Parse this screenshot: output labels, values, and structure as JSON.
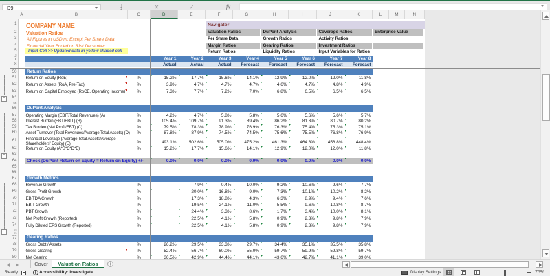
{
  "app": {
    "name_box": "D9",
    "formula_bar": ""
  },
  "colors": {
    "excel_green": "#217346",
    "section_band_blue": "#4f81bd",
    "status_band_blue": "#dce6f1",
    "title_orange": "#ed7d31",
    "input_yellow": "#ffff99",
    "navigator_lavender": "#d8d4e6",
    "navigator_gray": "#bfbfbf",
    "check_blue": "#2121cc",
    "error_indicator_green": "#1e7e3e",
    "flag_red": "#d03020"
  },
  "columns": [
    "A",
    "B",
    "C",
    "D",
    "E",
    "F",
    "G",
    "H",
    "I",
    "J",
    "K",
    "L",
    "M",
    "N"
  ],
  "row_numbers": [
    1,
    2,
    3,
    4,
    5,
    6,
    7,
    8,
    50,
    51,
    52,
    53,
    54,
    55,
    56,
    57,
    58,
    59,
    60,
    61,
    62,
    63,
    64,
    65,
    66,
    67,
    68,
    69,
    70,
    71,
    72,
    73,
    74,
    75,
    76,
    77,
    78,
    79,
    80
  ],
  "outline_levels": [
    "1",
    "2"
  ],
  "title_block": {
    "company": "COMPANY NAME",
    "sheet_title": "Valuation Ratios",
    "note1": "All Figures in USD m; Except Per Share Data",
    "note2": "Financial Year Ended on 31st December",
    "input_note": "Input Cell >> Updated data in yellow shaded cell"
  },
  "navigator": {
    "title": "Navigator",
    "rows": [
      {
        "filled": true,
        "cells": [
          "Valuation Ratios",
          "DuPont Analysis",
          "Coverage Ratios",
          "Enterprise Value"
        ]
      },
      {
        "filled": false,
        "cells": [
          "Per Share Data",
          "Growth Ratios",
          "Activity Ratios",
          ""
        ]
      },
      {
        "filled": true,
        "cells": [
          "Margin Ratios",
          "Gearing Ratios",
          "Investment Ratios",
          ""
        ]
      },
      {
        "filled": false,
        "cells": [
          "Return Ratios",
          "Liquidity Ratios",
          "Input Variables for Ratios",
          ""
        ]
      }
    ]
  },
  "table": {
    "year_header": [
      "Year 1",
      "Year 2",
      "Year 3",
      "Year 4",
      "Year 5",
      "Year 6",
      "Year 7",
      "Year 8"
    ],
    "status_row": [
      "Actual",
      "Actual",
      "Actual",
      "Forecast",
      "Forecast",
      "Forecast",
      "Forecast",
      "Forecast"
    ],
    "sections": [
      {
        "row": 50,
        "title": "Return Ratios",
        "rows": [
          {
            "row": 51,
            "label": "Return on Equity (RoE)",
            "unit": "%",
            "flag": true,
            "values": [
              "15.2%",
              "17.7%",
              "15.6%",
              "14.1%",
              "12.9%",
              "12.0%",
              "12.0%",
              "11.8%"
            ]
          },
          {
            "row": 52,
            "label": "Return on Assets (RoA, Pre-Tax)",
            "unit": "%",
            "flag": true,
            "values": [
              "3.9%",
              "4.7%",
              "4.7%",
              "4.7%",
              "4.6%",
              "4.7%",
              "4.8%",
              "4.9%"
            ]
          },
          {
            "row": 53,
            "label": "Return on Capital Employed (RoCE, Operating Income)",
            "unit": "%",
            "flag": true,
            "values": [
              "7.3%",
              "7.7%",
              "7.2%",
              "7.0%",
              "6.8%",
              "6.5%",
              "6.5%",
              "6.5%"
            ]
          }
        ]
      },
      {
        "row": 56,
        "title": "DuPont Analysis",
        "rows": [
          {
            "row": 57,
            "label": "Operating Margin (EBIT/Total Revenues) (A)",
            "unit": "%",
            "values": [
              "4.2%",
              "4.7%",
              "5.8%",
              "5.8%",
              "5.6%",
              "5.6%",
              "5.6%",
              "5.7%"
            ]
          },
          {
            "row": 58,
            "label": "Interest Burden (EBT/EBIT) (B)",
            "unit": "%",
            "values": [
              "105.4%",
              "109.7%",
              "91.3%",
              "89.4%",
              "86.2%",
              "81.3%",
              "80.7%",
              "80.2%"
            ]
          },
          {
            "row": 59,
            "label": "Tax Burden (Net Profit/EBT) (C)",
            "unit": "%",
            "values": [
              "79.5%",
              "78.3%",
              "78.9%",
              "76.9%",
              "76.3%",
              "75.4%",
              "75.3%",
              "75.1%"
            ]
          },
          {
            "row": 60,
            "label": "Asset Turnover (Total Revenues/Average Total Assets) (D)",
            "unit": "%",
            "values": [
              "87.8%",
              "87.9%",
              "74.5%",
              "74.5%",
              "75.6%",
              "75.5%",
              "76.8%",
              "76.9%"
            ]
          },
          {
            "row": 61,
            "label": "Financial Leverage (Average Total Assets/Average Shareholders' Equity) (E)",
            "two_line": true,
            "unit": "%",
            "values": [
              "493.1%",
              "502.6%",
              "505.0%",
              "475.2%",
              "461.3%",
              "464.8%",
              "456.8%",
              "448.4%"
            ]
          },
          {
            "row": 62,
            "label": "Return on Equity (A*B*C*D*E)",
            "unit": "%",
            "values": [
              "15.2%",
              "17.7%",
              "15.6%",
              "14.1%",
              "12.9%",
              "12.0%",
              "12.0%",
              "11.8%"
            ]
          }
        ]
      },
      {
        "row": 64,
        "title": "Check (DuPont Return on Equity = Return on Equity) +/-",
        "check": true,
        "values": [
          "0.0%",
          "0.0%",
          "0.0%",
          "0.0%",
          "0.0%",
          "0.0%",
          "0.0%",
          "0.0%"
        ],
        "rows": []
      },
      {
        "row": 67,
        "title": "Growth Metrics",
        "rows": [
          {
            "row": 68,
            "label": "Revenue Growth",
            "unit": "%",
            "values": [
              "",
              "7.9%",
              "0.4%",
              "10.0%",
              "9.2%",
              "10.6%",
              "9.6%",
              "7.7%"
            ]
          },
          {
            "row": 69,
            "label": "Gross Profit Growth",
            "unit": "%",
            "values": [
              "",
              "20.0%",
              "16.8%",
              "9.0%",
              "7.3%",
              "10.1%",
              "10.2%",
              "8.2%"
            ]
          },
          {
            "row": 70,
            "label": "EBITDA Growth",
            "unit": "%",
            "values": [
              "",
              "17.3%",
              "18.8%",
              "4.3%",
              "6.3%",
              "8.9%",
              "9.4%",
              "7.6%"
            ]
          },
          {
            "row": 71,
            "label": "EBIT Growth",
            "unit": "%",
            "values": [
              "",
              "19.5%",
              "24.1%",
              "11.0%",
              "5.5%",
              "9.6%",
              "10.8%",
              "8.7%"
            ]
          },
          {
            "row": 72,
            "label": "PBT Growth",
            "unit": "%",
            "values": [
              "",
              "24.4%",
              "3.3%",
              "8.6%",
              "1.7%",
              "3.4%",
              "10.0%",
              "8.1%"
            ]
          },
          {
            "row": 73,
            "label": "Net Profit Growth (Reported)",
            "unit": "%",
            "values": [
              "",
              "22.5%",
              "4.1%",
              "5.8%",
              "0.9%",
              "2.3%",
              "9.8%",
              "7.9%"
            ]
          },
          {
            "row": 74,
            "label": "Fully Diluted EPS Growth (Reported)",
            "unit": "%",
            "values": [
              "",
              "22.5%",
              "4.1%",
              "5.8%",
              "0.9%",
              "2.3%",
              "9.8%",
              "7.9%"
            ]
          }
        ]
      },
      {
        "row": 77,
        "title": "Gearing Ratios",
        "rows": [
          {
            "row": 78,
            "label": "Gross Debt / Assets",
            "unit": "%",
            "values": [
              "26.2%",
              "29.5%",
              "33.3%",
              "29.7%",
              "34.4%",
              "35.1%",
              "35.5%",
              "35.8%"
            ]
          },
          {
            "row": 79,
            "label": "Gross Gearing",
            "unit": "%",
            "flag": true,
            "values": [
              "52.4%",
              "56.7%",
              "60.0%",
              "55.0%",
              "59.7%",
              "59.9%",
              "59.8%",
              "59.7%"
            ]
          },
          {
            "row": 80,
            "label": "Net Gearing",
            "unit": "%",
            "values": [
              "36.5%",
              "42.9%",
              "44.4%",
              "44.1%",
              "43.6%",
              "42.7%",
              "41.1%",
              "39.0%"
            ]
          }
        ]
      }
    ]
  },
  "sheet_tabs": {
    "tabs": [
      {
        "label": "Cover",
        "active": false
      },
      {
        "label": "Valuation Ratios",
        "active": true
      }
    ],
    "add_label": "+"
  },
  "status_bar": {
    "ready": "Ready",
    "accessibility": "Accessibility: Investigate",
    "display_settings": "Display Settings",
    "zoom_level": "75%"
  }
}
